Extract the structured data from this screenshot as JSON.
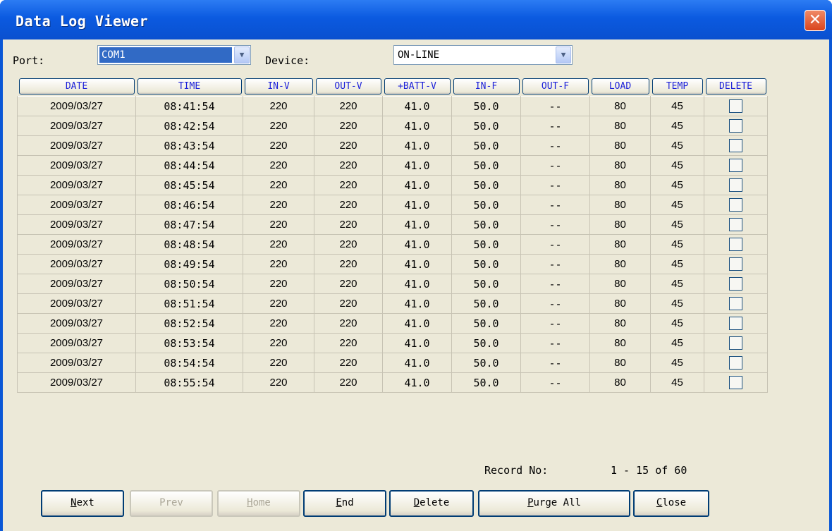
{
  "window": {
    "title": "Data Log Viewer"
  },
  "icons": {
    "close": "close-icon",
    "dropdown": "chevron-down-icon"
  },
  "filters": {
    "port_label": "Port:",
    "port_value": "COM1",
    "device_label": "Device:",
    "device_value": "ON-LINE"
  },
  "table": {
    "columns": [
      "DATE",
      "TIME",
      "IN-V",
      "OUT-V",
      "+BATT-V",
      "IN-F",
      "OUT-F",
      "LOAD",
      "TEMP",
      "DELETE"
    ],
    "rows": [
      [
        "2009/03/27",
        "08:41:54",
        "220",
        "220",
        "41.0",
        "50.0",
        "--",
        "80",
        "45",
        false
      ],
      [
        "2009/03/27",
        "08:42:54",
        "220",
        "220",
        "41.0",
        "50.0",
        "--",
        "80",
        "45",
        false
      ],
      [
        "2009/03/27",
        "08:43:54",
        "220",
        "220",
        "41.0",
        "50.0",
        "--",
        "80",
        "45",
        false
      ],
      [
        "2009/03/27",
        "08:44:54",
        "220",
        "220",
        "41.0",
        "50.0",
        "--",
        "80",
        "45",
        false
      ],
      [
        "2009/03/27",
        "08:45:54",
        "220",
        "220",
        "41.0",
        "50.0",
        "--",
        "80",
        "45",
        false
      ],
      [
        "2009/03/27",
        "08:46:54",
        "220",
        "220",
        "41.0",
        "50.0",
        "--",
        "80",
        "45",
        false
      ],
      [
        "2009/03/27",
        "08:47:54",
        "220",
        "220",
        "41.0",
        "50.0",
        "--",
        "80",
        "45",
        false
      ],
      [
        "2009/03/27",
        "08:48:54",
        "220",
        "220",
        "41.0",
        "50.0",
        "--",
        "80",
        "45",
        false
      ],
      [
        "2009/03/27",
        "08:49:54",
        "220",
        "220",
        "41.0",
        "50.0",
        "--",
        "80",
        "45",
        false
      ],
      [
        "2009/03/27",
        "08:50:54",
        "220",
        "220",
        "41.0",
        "50.0",
        "--",
        "80",
        "45",
        false
      ],
      [
        "2009/03/27",
        "08:51:54",
        "220",
        "220",
        "41.0",
        "50.0",
        "--",
        "80",
        "45",
        false
      ],
      [
        "2009/03/27",
        "08:52:54",
        "220",
        "220",
        "41.0",
        "50.0",
        "--",
        "80",
        "45",
        false
      ],
      [
        "2009/03/27",
        "08:53:54",
        "220",
        "220",
        "41.0",
        "50.0",
        "--",
        "80",
        "45",
        false
      ],
      [
        "2009/03/27",
        "08:54:54",
        "220",
        "220",
        "41.0",
        "50.0",
        "--",
        "80",
        "45",
        false
      ],
      [
        "2009/03/27",
        "08:55:54",
        "220",
        "220",
        "41.0",
        "50.0",
        "--",
        "80",
        "45",
        false
      ]
    ]
  },
  "record": {
    "label": "Record No:",
    "range": "1 - 15 of 60"
  },
  "buttons": {
    "next": {
      "first": "N",
      "rest": "ext",
      "enabled": true
    },
    "prev": {
      "first": "P",
      "rest": "rev",
      "enabled": false,
      "underline_index": 1
    },
    "home": {
      "first": "H",
      "rest": "ome",
      "enabled": false
    },
    "end": {
      "first": "E",
      "rest": "nd",
      "enabled": true
    },
    "delete": {
      "first": "D",
      "rest": "elete",
      "enabled": true
    },
    "purge_all": {
      "first": "P",
      "rest": "urge All",
      "enabled": true
    },
    "close": {
      "first": "C",
      "rest": "lose",
      "enabled": true
    }
  },
  "colors": {
    "titlebar": "#0b5ae0",
    "dialog_bg": "#ece9d8",
    "header_text": "#1e22d9",
    "selection": "#316ac5"
  }
}
